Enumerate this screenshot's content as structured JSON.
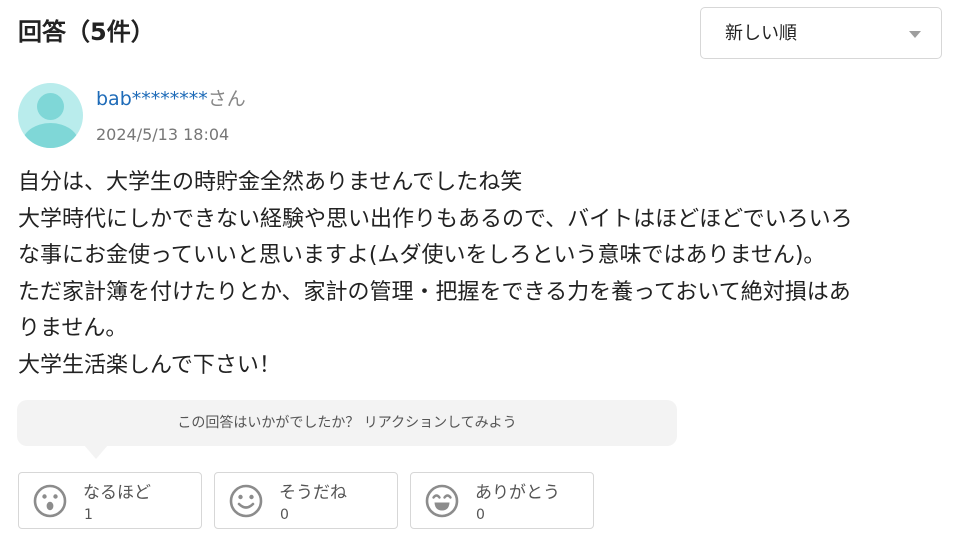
{
  "header": {
    "title": "回答（5件）",
    "sort": {
      "selected": "新しい順",
      "icon": "caret-down-icon"
    }
  },
  "answer": {
    "user": {
      "name": "bab********",
      "suffix": "さん",
      "avatar_icon": "default-user-avatar"
    },
    "timestamp": "2024/5/13 18:04",
    "lines": [
      "自分は、大学生の時貯金全然ありませんでしたね笑",
      "大学時代にしかできない経験や思い出作りもあるので、バイトはほどほどでいろいろ",
      "な事にお金使っていいと思いますよ(ムダ使いをしろという意味ではありません)。",
      "ただ家計簿を付けたりとか、家計の管理・把握をできる力を養っておいて絶対損はあ",
      "りません。",
      "大学生活楽しんで下さい！"
    ]
  },
  "reactions": {
    "prompt": "この回答はいかがでしたか？ リアクションしてみよう",
    "buttons": [
      {
        "label": "なるほど",
        "count": "1",
        "icon": "surprised-face-icon"
      },
      {
        "label": "そうだね",
        "count": "0",
        "icon": "smile-face-icon"
      },
      {
        "label": "ありがとう",
        "count": "0",
        "icon": "grin-face-icon"
      }
    ]
  },
  "colors": {
    "username": "#1e6bb8",
    "avatar_bg": "#b9ecec",
    "avatar_fg": "#7fd7d7",
    "icon_gray": "#8c8c8c"
  }
}
